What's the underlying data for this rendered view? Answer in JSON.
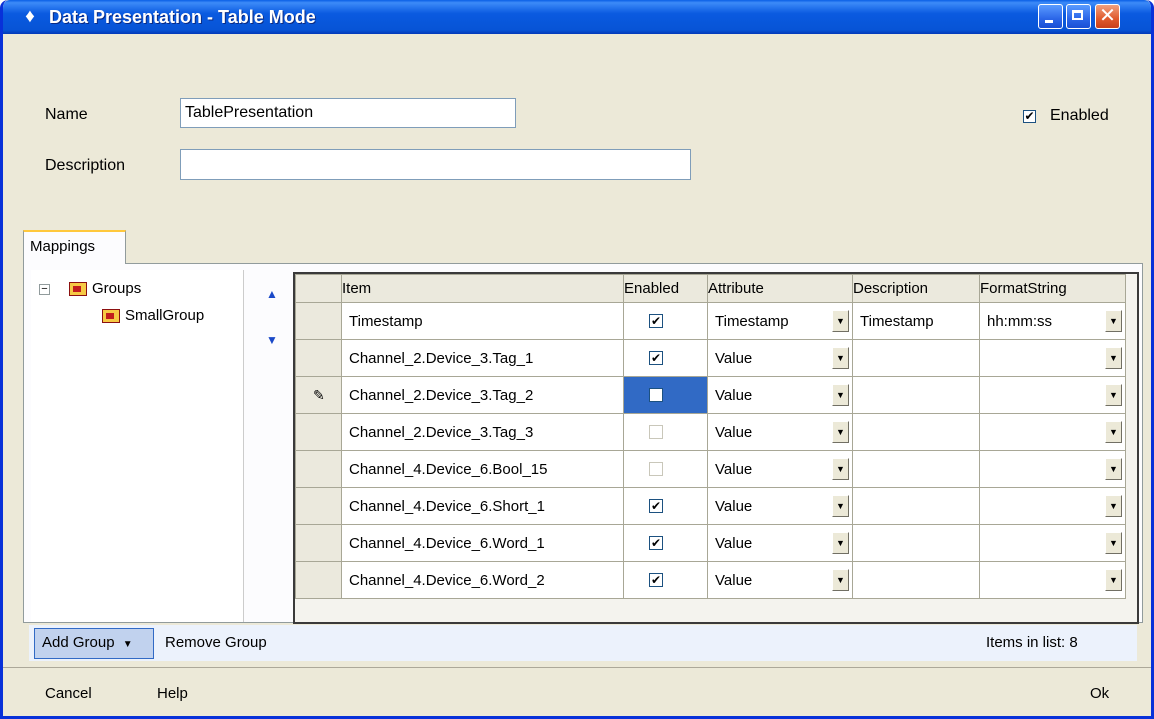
{
  "window": {
    "title": "Data Presentation - Table Mode"
  },
  "form": {
    "name_label": "Name",
    "name_value": "TablePresentation",
    "description_label": "Description",
    "description_value": "",
    "enabled_label": "Enabled",
    "enabled_checked": true
  },
  "tabs": [
    {
      "label": "Mappings"
    }
  ],
  "tree": {
    "root": "Groups",
    "expander": "−",
    "children": [
      "SmallGroup"
    ]
  },
  "grid": {
    "columns": [
      "Item",
      "Enabled",
      "Attribute",
      "Description",
      "FormatString"
    ],
    "rows": [
      {
        "item": "Timestamp",
        "enabled": true,
        "attribute": "Timestamp",
        "description": "Timestamp",
        "format": "hh:mm:ss"
      },
      {
        "item": "Channel_2.Device_3.Tag_1",
        "enabled": true,
        "attribute": "Value",
        "description": "",
        "format": ""
      },
      {
        "item": "Channel_2.Device_3.Tag_2",
        "enabled": false,
        "attribute": "Value",
        "description": "",
        "format": "",
        "editing": true
      },
      {
        "item": "Channel_2.Device_3.Tag_3",
        "enabled": false,
        "attribute": "Value",
        "description": "",
        "format": ""
      },
      {
        "item": "Channel_4.Device_6.Bool_15",
        "enabled": false,
        "attribute": "Value",
        "description": "",
        "format": ""
      },
      {
        "item": "Channel_4.Device_6.Short_1",
        "enabled": true,
        "attribute": "Value",
        "description": "",
        "format": ""
      },
      {
        "item": "Channel_4.Device_6.Word_1",
        "enabled": true,
        "attribute": "Value",
        "description": "",
        "format": ""
      },
      {
        "item": "Channel_4.Device_6.Word_2",
        "enabled": true,
        "attribute": "Value",
        "description": "",
        "format": ""
      }
    ]
  },
  "toolbar": {
    "add_group": "Add Group",
    "remove_group": "Remove Group",
    "items_count": "Items in list: 8"
  },
  "footer": {
    "cancel": "Cancel",
    "help": "Help",
    "ok": "Ok"
  }
}
